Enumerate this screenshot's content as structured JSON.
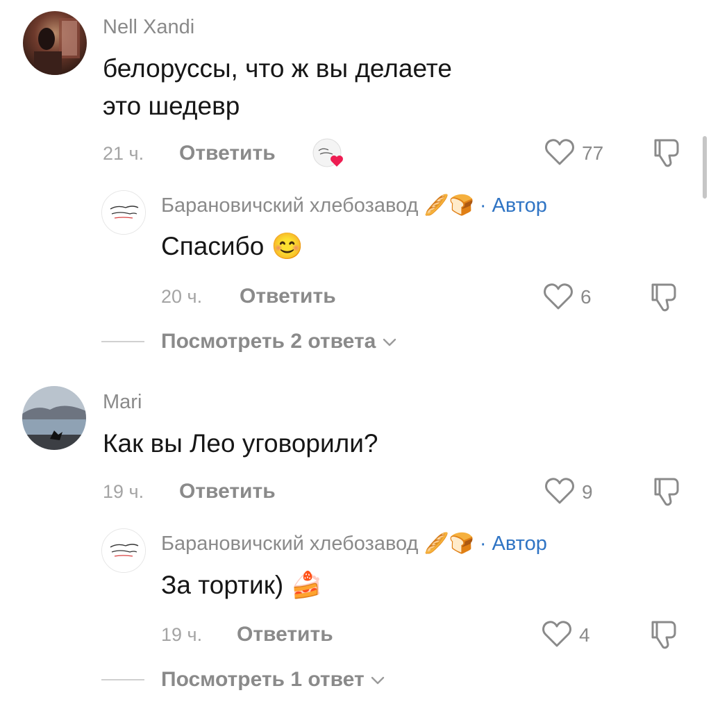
{
  "comments": [
    {
      "username": "Nell Xandi",
      "text_lines": [
        "белоруссы, что ж вы делаете",
        "это шедевр"
      ],
      "time": "21 ч.",
      "reply_label": "Ответить",
      "likes": "77",
      "liked_by_creator": true,
      "replies": [
        {
          "username": "Барановичский хлебозавод",
          "name_emoji": "🥖🍞",
          "author_badge": "· Автор",
          "text": "Спасибо",
          "text_emoji": "😊",
          "time": "20 ч.",
          "reply_label": "Ответить",
          "likes": "6"
        }
      ],
      "view_more": "Посмотреть 2 ответа"
    },
    {
      "username": "Mari",
      "text_lines": [
        "Как вы Лео уговорили?"
      ],
      "time": "19 ч.",
      "reply_label": "Ответить",
      "likes": "9",
      "replies": [
        {
          "username": "Барановичский хлебозавод",
          "name_emoji": "🥖🍞",
          "author_badge": "· Автор",
          "text": "За тортик)",
          "text_emoji": "🍰",
          "time": "19 ч.",
          "reply_label": "Ответить",
          "likes": "4"
        }
      ],
      "view_more": "Посмотреть 1 ответ"
    }
  ],
  "icons": {
    "like": "heart-outline-icon",
    "dislike": "thumbs-down-outline-icon",
    "creator_like": "creator-liked-heart-icon",
    "expand": "chevron-down-icon"
  },
  "colors": {
    "author_badge": "#2f74c4",
    "liked_heart": "#ee1d52",
    "secondary_text": "#8a8a8a"
  }
}
